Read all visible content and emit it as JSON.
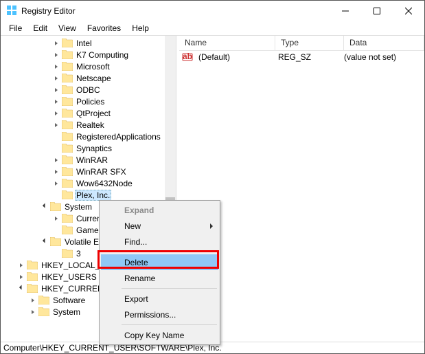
{
  "window": {
    "title": "Registry Editor"
  },
  "menu": {
    "file": "File",
    "edit": "Edit",
    "view": "View",
    "favorites": "Favorites",
    "help": "Help"
  },
  "tree": {
    "items": [
      {
        "d": 5,
        "e": "right",
        "l": "Intel"
      },
      {
        "d": 5,
        "e": "right",
        "l": "K7 Computing"
      },
      {
        "d": 5,
        "e": "right",
        "l": "Microsoft"
      },
      {
        "d": 5,
        "e": "right",
        "l": "Netscape"
      },
      {
        "d": 5,
        "e": "right",
        "l": "ODBC"
      },
      {
        "d": 5,
        "e": "right",
        "l": "Policies"
      },
      {
        "d": 5,
        "e": "right",
        "l": "QtProject"
      },
      {
        "d": 5,
        "e": "right",
        "l": "Realtek"
      },
      {
        "d": 5,
        "e": "none",
        "l": "RegisteredApplications"
      },
      {
        "d": 5,
        "e": "none",
        "l": "Synaptics"
      },
      {
        "d": 5,
        "e": "right",
        "l": "WinRAR"
      },
      {
        "d": 5,
        "e": "right",
        "l": "WinRAR SFX"
      },
      {
        "d": 5,
        "e": "right",
        "l": "Wow6432Node"
      },
      {
        "d": 5,
        "e": "none",
        "l": "Plex, Inc.",
        "sel": true
      },
      {
        "d": 4,
        "e": "down",
        "l": "System"
      },
      {
        "d": 5,
        "e": "right",
        "l": "CurrentControlSet"
      },
      {
        "d": 5,
        "e": "none",
        "l": "GameConfigStore"
      },
      {
        "d": 4,
        "e": "down",
        "l": "Volatile Environment"
      },
      {
        "d": 5,
        "e": "none",
        "l": "3"
      },
      {
        "d": 2,
        "e": "right",
        "l": "HKEY_LOCAL_MACHINE"
      },
      {
        "d": 2,
        "e": "right",
        "l": "HKEY_USERS"
      },
      {
        "d": 2,
        "e": "down",
        "l": "HKEY_CURRENT_CONFIG"
      },
      {
        "d": 3,
        "e": "right",
        "l": "Software"
      },
      {
        "d": 3,
        "e": "right",
        "l": "System"
      }
    ]
  },
  "list": {
    "headers": {
      "name": "Name",
      "type": "Type",
      "data": "Data"
    },
    "rows": [
      {
        "name": "(Default)",
        "type": "REG_SZ",
        "data": "(value not set)"
      }
    ]
  },
  "context": {
    "expand": "Expand",
    "new": "New",
    "find": "Find...",
    "delete": "Delete",
    "rename": "Rename",
    "export": "Export",
    "permissions": "Permissions...",
    "copykey": "Copy Key Name"
  },
  "status": {
    "path": "Computer\\HKEY_CURRENT_USER\\SOFTWARE\\Plex, Inc."
  }
}
